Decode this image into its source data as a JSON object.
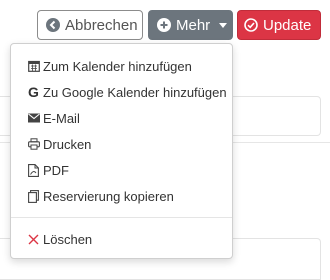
{
  "toolbar": {
    "cancel_label": "Abbrechen",
    "more_label": "Mehr",
    "update_label": "Update"
  },
  "menu": {
    "items": [
      {
        "label": "Zum Kalender hinzufügen",
        "icon": "calendar-icon"
      },
      {
        "label": "Zu Google Kalender hinzufügen",
        "icon": "google-icon"
      },
      {
        "label": "E-Mail",
        "icon": "envelope-icon"
      },
      {
        "label": "Drucken",
        "icon": "printer-icon"
      },
      {
        "label": "PDF",
        "icon": "pdf-file-icon"
      },
      {
        "label": "Reservierung kopieren",
        "icon": "copy-icon"
      }
    ],
    "delete_label": "Löschen",
    "delete_icon": "x-icon"
  },
  "colors": {
    "more_button": "#6c757d",
    "update_button": "#dc3545",
    "delete_icon": "#dc3545"
  }
}
